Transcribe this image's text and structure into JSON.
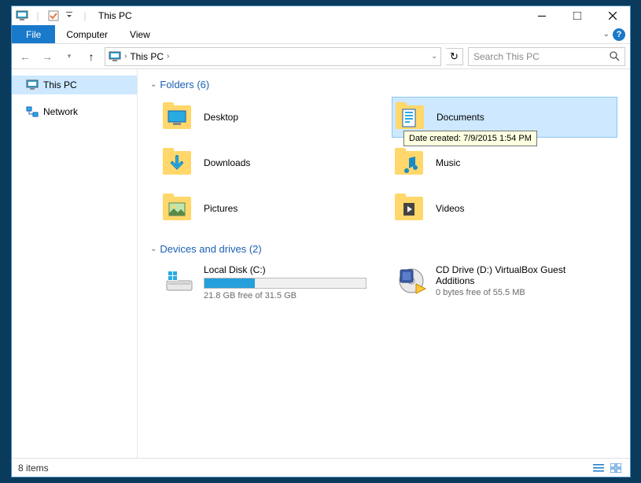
{
  "titlebar": {
    "title": "This PC"
  },
  "ribbon": {
    "file": "File",
    "tabs": [
      "Computer",
      "View"
    ]
  },
  "address": {
    "location": "This PC",
    "search_placeholder": "Search This PC"
  },
  "sidebar": {
    "items": [
      {
        "label": "This PC",
        "selected": true
      },
      {
        "label": "Network",
        "selected": false
      }
    ]
  },
  "groups": {
    "folders_header": "Folders (6)",
    "drives_header": "Devices and drives (2)"
  },
  "folders": [
    {
      "label": "Desktop"
    },
    {
      "label": "Documents",
      "selected": true
    },
    {
      "label": "Downloads"
    },
    {
      "label": "Music"
    },
    {
      "label": "Pictures"
    },
    {
      "label": "Videos"
    }
  ],
  "tooltip": {
    "text": "Date created: 7/9/2015 1:54 PM"
  },
  "drives": [
    {
      "name": "Local Disk (C:)",
      "free_text": "21.8 GB free of 31.5 GB",
      "fill_pct": 31
    },
    {
      "name": "CD Drive (D:) VirtualBox Guest Additions",
      "free_text": "0 bytes free of 55.5 MB"
    }
  ],
  "status": {
    "text": "8 items"
  }
}
